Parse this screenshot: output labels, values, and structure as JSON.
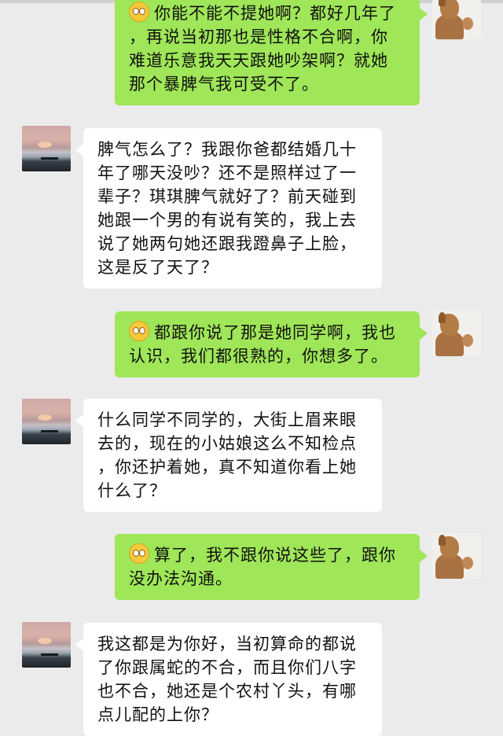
{
  "chat": {
    "messages": [
      {
        "side": "right",
        "emoji": "face-with-raised-eyebrow",
        "lines": [
          "你能不能不提她啊？都好几年了",
          "，再说当初那也是性格不合啊，你",
          "难道乐意我天天跟她吵架啊？就她",
          "那个暴脾气我可受不了。"
        ]
      },
      {
        "side": "left",
        "lines": [
          "脾气怎么了？我跟你爸都结婚几十",
          "年了哪天没吵？还不是照样过了一",
          "辈子？琪琪脾气就好了？前天碰到",
          "她跟一个男的有说有笑的，我上去",
          "说了她两句她还跟我蹬鼻子上脸，",
          "这是反了天了？"
        ]
      },
      {
        "side": "right",
        "emoji": "flushed-face",
        "lines": [
          "都跟你说了那是她同学啊，我也",
          "认识，我们都很熟的，你想多了。"
        ]
      },
      {
        "side": "left",
        "lines": [
          "什么同学不同学的，大街上眉来眼",
          "去的，现在的小姑娘这么不知检点",
          "，你还护着她，真不知道你看上她",
          "什么了？"
        ]
      },
      {
        "side": "right",
        "emoji": "relieved-face",
        "lines": [
          "算了，我不跟你说这些了，跟你",
          "没办法沟通。"
        ]
      },
      {
        "side": "left",
        "lines": [
          "我这都是为你好，当初算命的都说",
          "了你跟属蛇的不合，而且你们八字",
          "也不合，她还是个农村丫头，有哪",
          "点儿配的上你？"
        ]
      }
    ]
  },
  "colors": {
    "background": "#ebebeb",
    "sent_bubble": "#9fe658",
    "received_bubble": "#ffffff"
  }
}
